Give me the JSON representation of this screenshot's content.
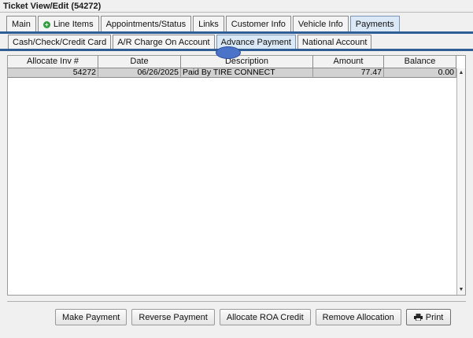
{
  "window": {
    "title": "Ticket View/Edit  (54272)"
  },
  "main_tabs": [
    {
      "label": "Main"
    },
    {
      "label": "Line Items"
    },
    {
      "label": "Appointments/Status"
    },
    {
      "label": "Links"
    },
    {
      "label": "Customer Info"
    },
    {
      "label": "Vehicle Info"
    },
    {
      "label": "Payments"
    }
  ],
  "payment_tabs": [
    {
      "label": "Cash/Check/Credit Card"
    },
    {
      "label": "A/R Charge On Account"
    },
    {
      "label": "Advance Payment"
    },
    {
      "label": "National Account"
    }
  ],
  "table": {
    "columns": [
      "Allocate Inv #",
      "Date",
      "Description",
      "Amount",
      "Balance"
    ],
    "rows": [
      {
        "inv": "54272",
        "date": "06/26/2025",
        "description": "Paid By TIRE CONNECT",
        "amount": "77.47",
        "balance": "0.00"
      }
    ]
  },
  "buttons": {
    "make_payment": "Make Payment",
    "reverse_payment": "Reverse Payment",
    "allocate_roa": "Allocate ROA Credit",
    "remove_allocation": "Remove Allocation",
    "print": "Print"
  },
  "icons": {
    "add": "plus-circle-icon",
    "print": "printer-icon"
  },
  "colors": {
    "accent_bar": "#2f5d95",
    "active_tab": "#dbe8f5",
    "selected_row": "#d2d2d2",
    "add_icon": "#2e9e3c",
    "marker": "#4b73c8"
  }
}
